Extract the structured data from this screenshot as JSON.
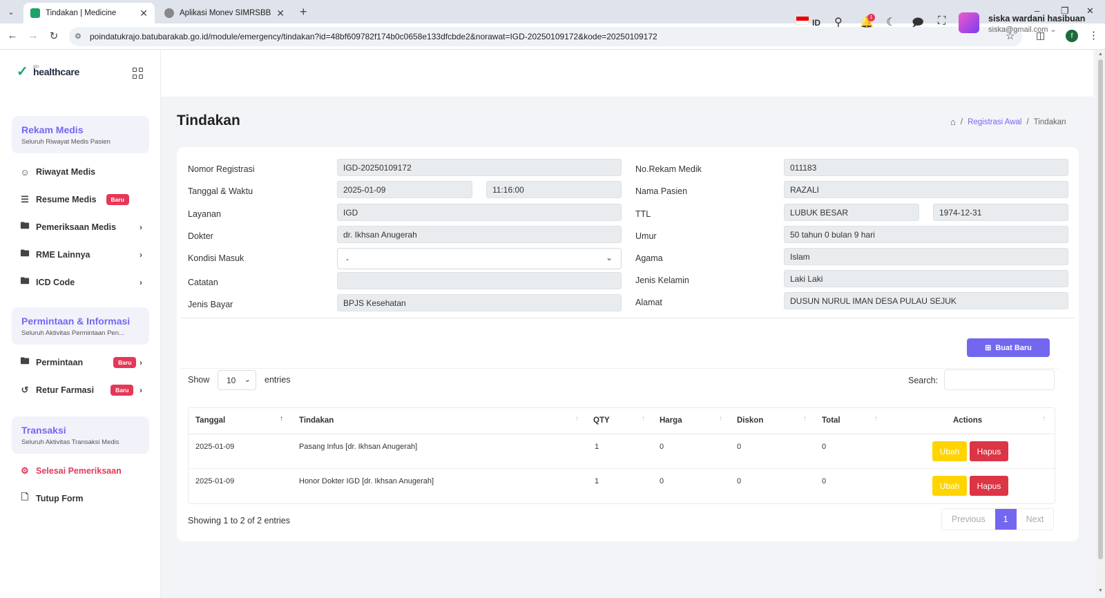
{
  "browser": {
    "tabs": [
      {
        "title": "Tindakan | Medicine",
        "active": true
      },
      {
        "title": "Aplikasi Monev SIMRSBB",
        "active": false
      }
    ],
    "url": "poindatukrajo.batubarakab.go.id/module/emergency/tindakan?id=48bf609782f174b0c0658e133dfcbde2&norawat=IGD-20250109172&kode=20250109172",
    "profile_initial": "f"
  },
  "sidebar": {
    "logo_small": "glu",
    "logo_text": "healthcare",
    "sections": [
      {
        "title": "Rekam Medis",
        "subtitle": "Seluruh Riwayat Medis Pasien"
      },
      {
        "title": "Permintaan & Informasi",
        "subtitle": "Seluruh Aktivitas Permintaan Pen..."
      },
      {
        "title": "Transaksi",
        "subtitle": "Seluruh Aktivitas Transaksi Medis"
      }
    ],
    "items": [
      {
        "label": "Riwayat Medis",
        "icon": "user-icon"
      },
      {
        "label": "Resume Medis",
        "icon": "list-icon",
        "badge": "Baru"
      },
      {
        "label": "Pemeriksaan Medis",
        "icon": "folder-icon"
      },
      {
        "label": "RME Lainnya",
        "icon": "folder-icon"
      },
      {
        "label": "ICD Code",
        "icon": "folder-icon"
      },
      {
        "label": "Permintaan",
        "icon": "folder-icon",
        "badge": "Baru"
      },
      {
        "label": "Retur Farmasi",
        "icon": "return-icon",
        "badge": "Baru"
      },
      {
        "label": "Selesai Pemeriksaan",
        "icon": "gear-icon"
      },
      {
        "label": "Tutup Form",
        "icon": "file-icon"
      }
    ]
  },
  "header": {
    "lang": "ID",
    "notif_count": "1",
    "user_name": "siska wardani hasibuan",
    "user_email": "siska@gmail.com"
  },
  "page": {
    "title": "Tindakan",
    "breadcrumb": [
      "Registrasi Awal",
      "Tindakan"
    ]
  },
  "form": {
    "left": [
      {
        "label": "Nomor Registrasi",
        "value": "IGD-20250109172"
      },
      {
        "label": "Tanggal & Waktu",
        "value": "2025-01-09",
        "value2": "11:16:00"
      },
      {
        "label": "Layanan",
        "value": "IGD"
      },
      {
        "label": "Dokter",
        "value": "dr. Ikhsan Anugerah"
      },
      {
        "label": "Kondisi Masuk",
        "value": "-"
      },
      {
        "label": "Catatan",
        "value": ""
      },
      {
        "label": "Jenis Bayar",
        "value": "BPJS Kesehatan"
      }
    ],
    "right": [
      {
        "label": "No.Rekam Medik",
        "value": "011183"
      },
      {
        "label": "Nama Pasien",
        "value": "RAZALI"
      },
      {
        "label": "TTL",
        "value": "LUBUK BESAR",
        "value2": "1974-12-31"
      },
      {
        "label": "Umur",
        "value": "50 tahun 0 bulan 9 hari"
      },
      {
        "label": "Agama",
        "value": "Islam"
      },
      {
        "label": "Jenis Kelamin",
        "value": "Laki Laki"
      },
      {
        "label": "Alamat",
        "value": "DUSUN NURUL IMAN DESA PULAU SEJUK"
      }
    ]
  },
  "table_ctrl": {
    "new_button": "Buat Baru",
    "show": "Show",
    "length": "10",
    "entries": "entries",
    "search": "Search:"
  },
  "table": {
    "headers": [
      "Tanggal",
      "Tindakan",
      "QTY",
      "Harga",
      "Diskon",
      "Total",
      "Actions"
    ],
    "rows": [
      {
        "tanggal": "2025-01-09",
        "tindakan": "Pasang Infus [dr. Ikhsan Anugerah]",
        "qty": "1",
        "harga": "0",
        "diskon": "0",
        "total": "0"
      },
      {
        "tanggal": "2025-01-09",
        "tindakan": "Honor Dokter IGD [dr. Ikhsan Anugerah]",
        "qty": "1",
        "harga": "0",
        "diskon": "0",
        "total": "0"
      }
    ],
    "edit_label": "Ubah",
    "delete_label": "Hapus",
    "info": "Showing 1 to 2 of 2 entries",
    "pager": [
      "Previous",
      "1",
      "Next"
    ]
  },
  "colors": {
    "accent": "#7367f0",
    "danger": "#e63757",
    "warning": "#ffd400",
    "brand_green": "#1aa36b"
  }
}
